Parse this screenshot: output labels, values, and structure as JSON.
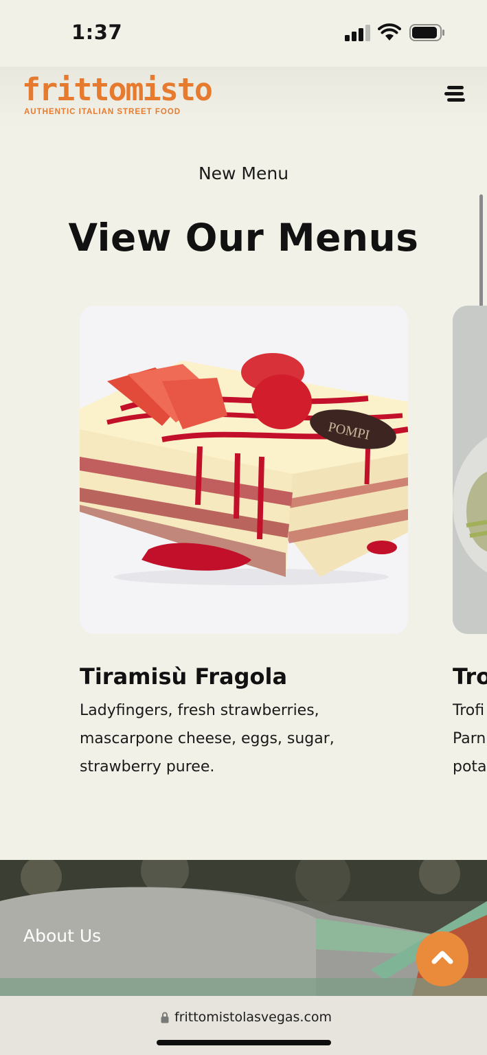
{
  "status_bar": {
    "time": "1:37",
    "icons": [
      "signal-icon",
      "wifi-icon",
      "battery-icon"
    ]
  },
  "header": {
    "brand_name": "frittomisto",
    "brand_tagline": "AUTHENTIC ITALIAN STREET FOOD",
    "menu_icon": "menu-icon"
  },
  "main": {
    "eyebrow": "New Menu",
    "title": "View Our Menus",
    "cards": [
      {
        "title": "Tiramisù Fragola",
        "description": "Ladyfingers, fresh strawberries, mascarpone cheese, eggs, sugar, strawberry puree.",
        "image_text": "POMPI"
      },
      {
        "title": "Tro",
        "description_lines": [
          "Trofi",
          "Parn",
          "pota"
        ]
      }
    ]
  },
  "about": {
    "label": "About Us",
    "back_to_top_icon": "chevron-up-icon"
  },
  "browser": {
    "url": "frittomistolasvegas.com"
  },
  "colors": {
    "brand": "#e67b2f",
    "background": "#f2f1e7",
    "button": "#ea8a3b"
  }
}
